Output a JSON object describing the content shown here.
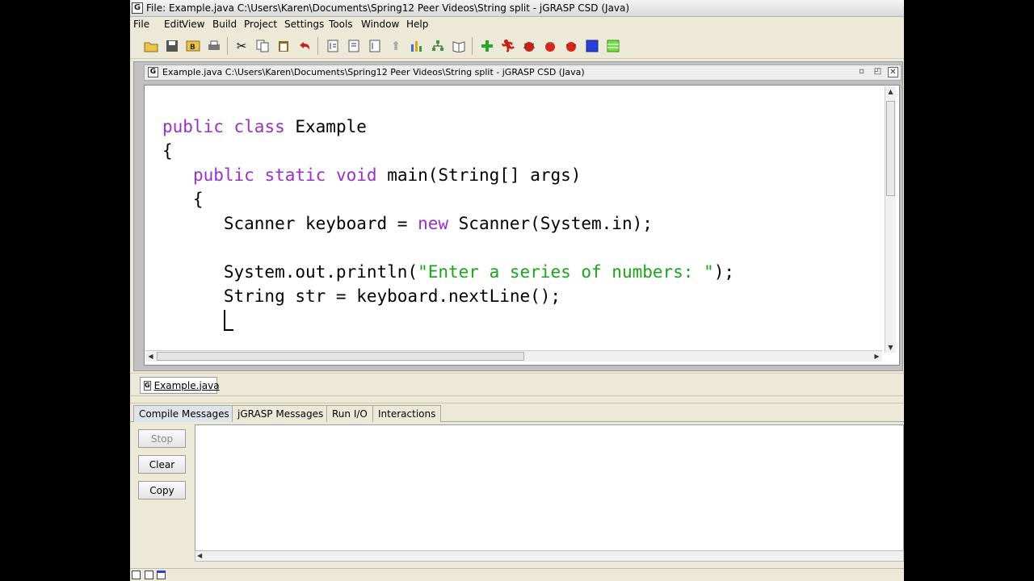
{
  "window": {
    "title": "File: Example.java  C:\\Users\\Karen\\Documents\\Spring12 Peer Videos\\String split - jGRASP CSD (Java)",
    "app_icon": "G"
  },
  "menu": [
    "File",
    "Edit",
    "View",
    "Build",
    "Project",
    "Settings",
    "Tools",
    "Window",
    "Help"
  ],
  "toolbar": {
    "icons": [
      "open-folder-icon",
      "save-icon",
      "browse-icon",
      "print-icon",
      "cut-icon",
      "copy-icon",
      "paste-icon",
      "undo-icon",
      "generate-csd-icon",
      "remove-csd-icon",
      "fold-icon",
      "unfold-icon",
      "chart-icon",
      "tree-icon",
      "book-icon",
      "compile-icon",
      "run-icon",
      "debug-icon",
      "apple-icon",
      "apple-debug-icon",
      "blue-square-icon",
      "green-square-icon"
    ]
  },
  "document": {
    "title": "Example.java  C:\\Users\\Karen\\Documents\\Spring12 Peer Videos\\String split - jGRASP CSD (Java)",
    "icon": "G",
    "code": {
      "line1": {
        "kw1": "public",
        "kw2": "class",
        "rest": " Example"
      },
      "line2": "{",
      "line3": {
        "indent": "   ",
        "kw1": "public",
        "kw2": "static",
        "kw3": "void",
        "rest": " main(String[] args)"
      },
      "line4": "   {",
      "line5": {
        "pre": "      Scanner keyboard = ",
        "kw": "new",
        "post": " Scanner(System.in);"
      },
      "line7": {
        "pre": "      System.out.println(",
        "str": "\"Enter a series of numbers: \"",
        "post": ");"
      },
      "line8": "      String str = keyboard.nextLine();"
    }
  },
  "file_tab": {
    "label": "Example.java",
    "icon": "G"
  },
  "bottom_tabs": [
    "Compile Messages",
    "jGRASP Messages",
    "Run I/O",
    "Interactions"
  ],
  "side_buttons": {
    "stop": "Stop",
    "clear": "Clear",
    "copy": "Copy"
  }
}
